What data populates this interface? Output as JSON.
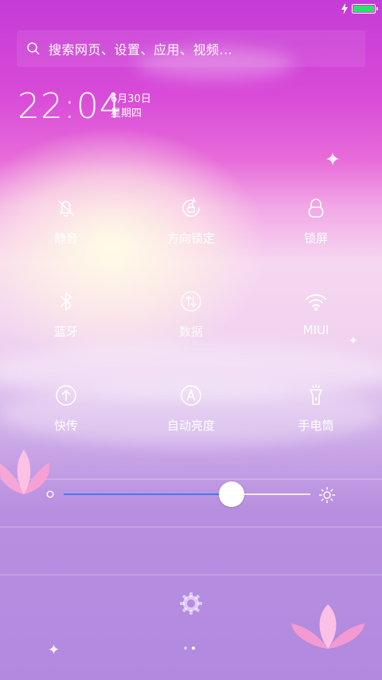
{
  "status_bar": {
    "battery_color": "#2de26b",
    "charging": true
  },
  "search": {
    "placeholder": "搜索网页、设置、应用、视频..."
  },
  "clock": {
    "time": "22:04",
    "date": "6月30日",
    "weekday": "星期四"
  },
  "toggles": [
    {
      "id": "mute",
      "label": "静音",
      "icon": "bell-off-icon",
      "active": false
    },
    {
      "id": "rotation-lock",
      "label": "方向锁定",
      "icon": "rotation-lock-icon",
      "active": false
    },
    {
      "id": "lock-screen",
      "label": "锁屏",
      "icon": "lock-icon",
      "active": false
    },
    {
      "id": "bluetooth",
      "label": "蓝牙",
      "icon": "bluetooth-icon",
      "active": false
    },
    {
      "id": "mobile-data",
      "label": "数据",
      "icon": "data-icon",
      "active": false
    },
    {
      "id": "wifi",
      "label": "MIUI",
      "icon": "wifi-icon",
      "active": true
    },
    {
      "id": "quick-share",
      "label": "快传",
      "icon": "upload-icon",
      "active": false
    },
    {
      "id": "auto-brightness",
      "label": "自动亮度",
      "icon": "auto-brightness-icon",
      "active": false
    },
    {
      "id": "flashlight",
      "label": "手电筒",
      "icon": "flashlight-icon",
      "active": false
    }
  ],
  "brightness": {
    "level": 0.68,
    "track_color": "#3f7cf0"
  },
  "pager": {
    "count": 2,
    "current": 2
  },
  "settings": {
    "icon": "gear-icon"
  }
}
